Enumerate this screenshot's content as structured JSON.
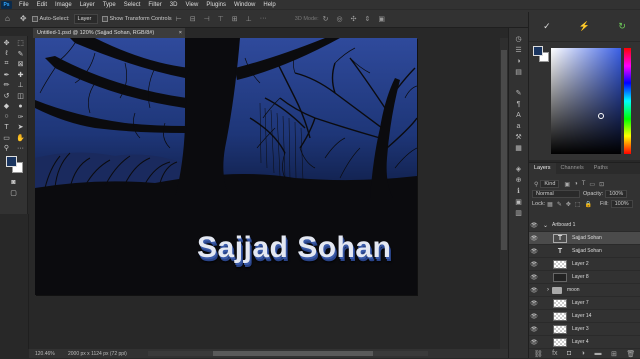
{
  "app": {
    "logo": "Ps"
  },
  "menu": [
    "File",
    "Edit",
    "Image",
    "Layer",
    "Type",
    "Select",
    "Filter",
    "3D",
    "View",
    "Plugins",
    "Window",
    "Help"
  ],
  "options": {
    "auto_select_label": "Auto-Select:",
    "auto_select_value": "Layer",
    "transform_label": "Show Transform Controls",
    "mode_label": "3D Mode:"
  },
  "document": {
    "tab_title": "Untitled-1.psd @ 120% (Sajjad Sohan, RGB/8#)",
    "close": "×",
    "signature_text": "Sajjad Sohan"
  },
  "status": {
    "zoom": "120.46%",
    "info": "2000 px x 1124 px (72 ppi)"
  },
  "colors": {
    "foreground": "#1a3560",
    "background": "#ffffff",
    "accent": "#31a8ff"
  },
  "layers_panel": {
    "tabs": [
      "Layers",
      "Channels",
      "Paths"
    ],
    "kind_label": "Kind",
    "blend_mode": "Normal",
    "opacity_label": "Opacity:",
    "opacity_value": "100%",
    "lock_label": "Lock:",
    "fill_label": "Fill:",
    "fill_value": "100%",
    "items": [
      {
        "name": "Artboard 1",
        "type": "artboard"
      },
      {
        "name": "Sajjad Sohan",
        "type": "text",
        "selected": true
      },
      {
        "name": "Sajjad Sohan",
        "type": "text"
      },
      {
        "name": "Layer 2",
        "type": "pixel"
      },
      {
        "name": "Layer 8",
        "type": "pixel"
      },
      {
        "name": "moon",
        "type": "group"
      },
      {
        "name": "Layer 7",
        "type": "pixel"
      },
      {
        "name": "Layer 14",
        "type": "pixel"
      },
      {
        "name": "Layer 3",
        "type": "pixel"
      },
      {
        "name": "Layer 4",
        "type": "pixel"
      }
    ]
  }
}
